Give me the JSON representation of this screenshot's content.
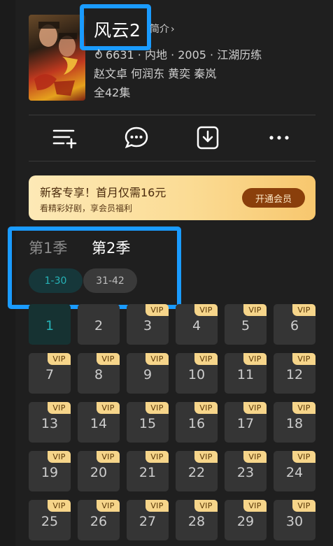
{
  "header": {
    "title": "风云2",
    "intro_link": "简介",
    "meta": "6631 · 内地 · 2005 · 江湖历练",
    "cast": "赵文卓 何润东 黄奕 秦岚",
    "episodes_total": "全42集"
  },
  "actions": [
    {
      "icon": "add-to-list-icon"
    },
    {
      "icon": "comment-icon"
    },
    {
      "icon": "download-icon"
    },
    {
      "icon": "more-icon"
    }
  ],
  "vip_banner": {
    "title": "新客专享！首月仅需16元",
    "subtitle": "看精彩好剧，享会员福利",
    "button": "开通会员"
  },
  "seasons": [
    {
      "label": "第1季",
      "selected": false
    },
    {
      "label": "第2季",
      "selected": true
    }
  ],
  "ranges": [
    {
      "label": "1-30",
      "selected": true
    },
    {
      "label": "31-42",
      "selected": false
    }
  ],
  "episodes": [
    {
      "n": "1",
      "vip": false,
      "active": true
    },
    {
      "n": "2",
      "vip": false
    },
    {
      "n": "3",
      "vip": true
    },
    {
      "n": "4",
      "vip": true
    },
    {
      "n": "5",
      "vip": true
    },
    {
      "n": "6",
      "vip": true
    },
    {
      "n": "7",
      "vip": true
    },
    {
      "n": "8",
      "vip": true
    },
    {
      "n": "9",
      "vip": true
    },
    {
      "n": "10",
      "vip": true
    },
    {
      "n": "11",
      "vip": true
    },
    {
      "n": "12",
      "vip": true
    },
    {
      "n": "13",
      "vip": true
    },
    {
      "n": "14",
      "vip": true
    },
    {
      "n": "15",
      "vip": true
    },
    {
      "n": "16",
      "vip": true
    },
    {
      "n": "17",
      "vip": true
    },
    {
      "n": "18",
      "vip": true
    },
    {
      "n": "19",
      "vip": true
    },
    {
      "n": "20",
      "vip": true
    },
    {
      "n": "21",
      "vip": true
    },
    {
      "n": "22",
      "vip": true
    },
    {
      "n": "23",
      "vip": true
    },
    {
      "n": "24",
      "vip": true
    },
    {
      "n": "25",
      "vip": true
    },
    {
      "n": "26",
      "vip": true
    },
    {
      "n": "27",
      "vip": true
    },
    {
      "n": "28",
      "vip": true
    },
    {
      "n": "29",
      "vip": true
    },
    {
      "n": "30",
      "vip": true
    }
  ],
  "vip_tag": "VIP",
  "colors": {
    "accent_teal": "#26b3b7",
    "highlight_blue": "#1a9bff",
    "vip_gold": "#f6d58a",
    "vip_button": "#8a3f0b"
  }
}
